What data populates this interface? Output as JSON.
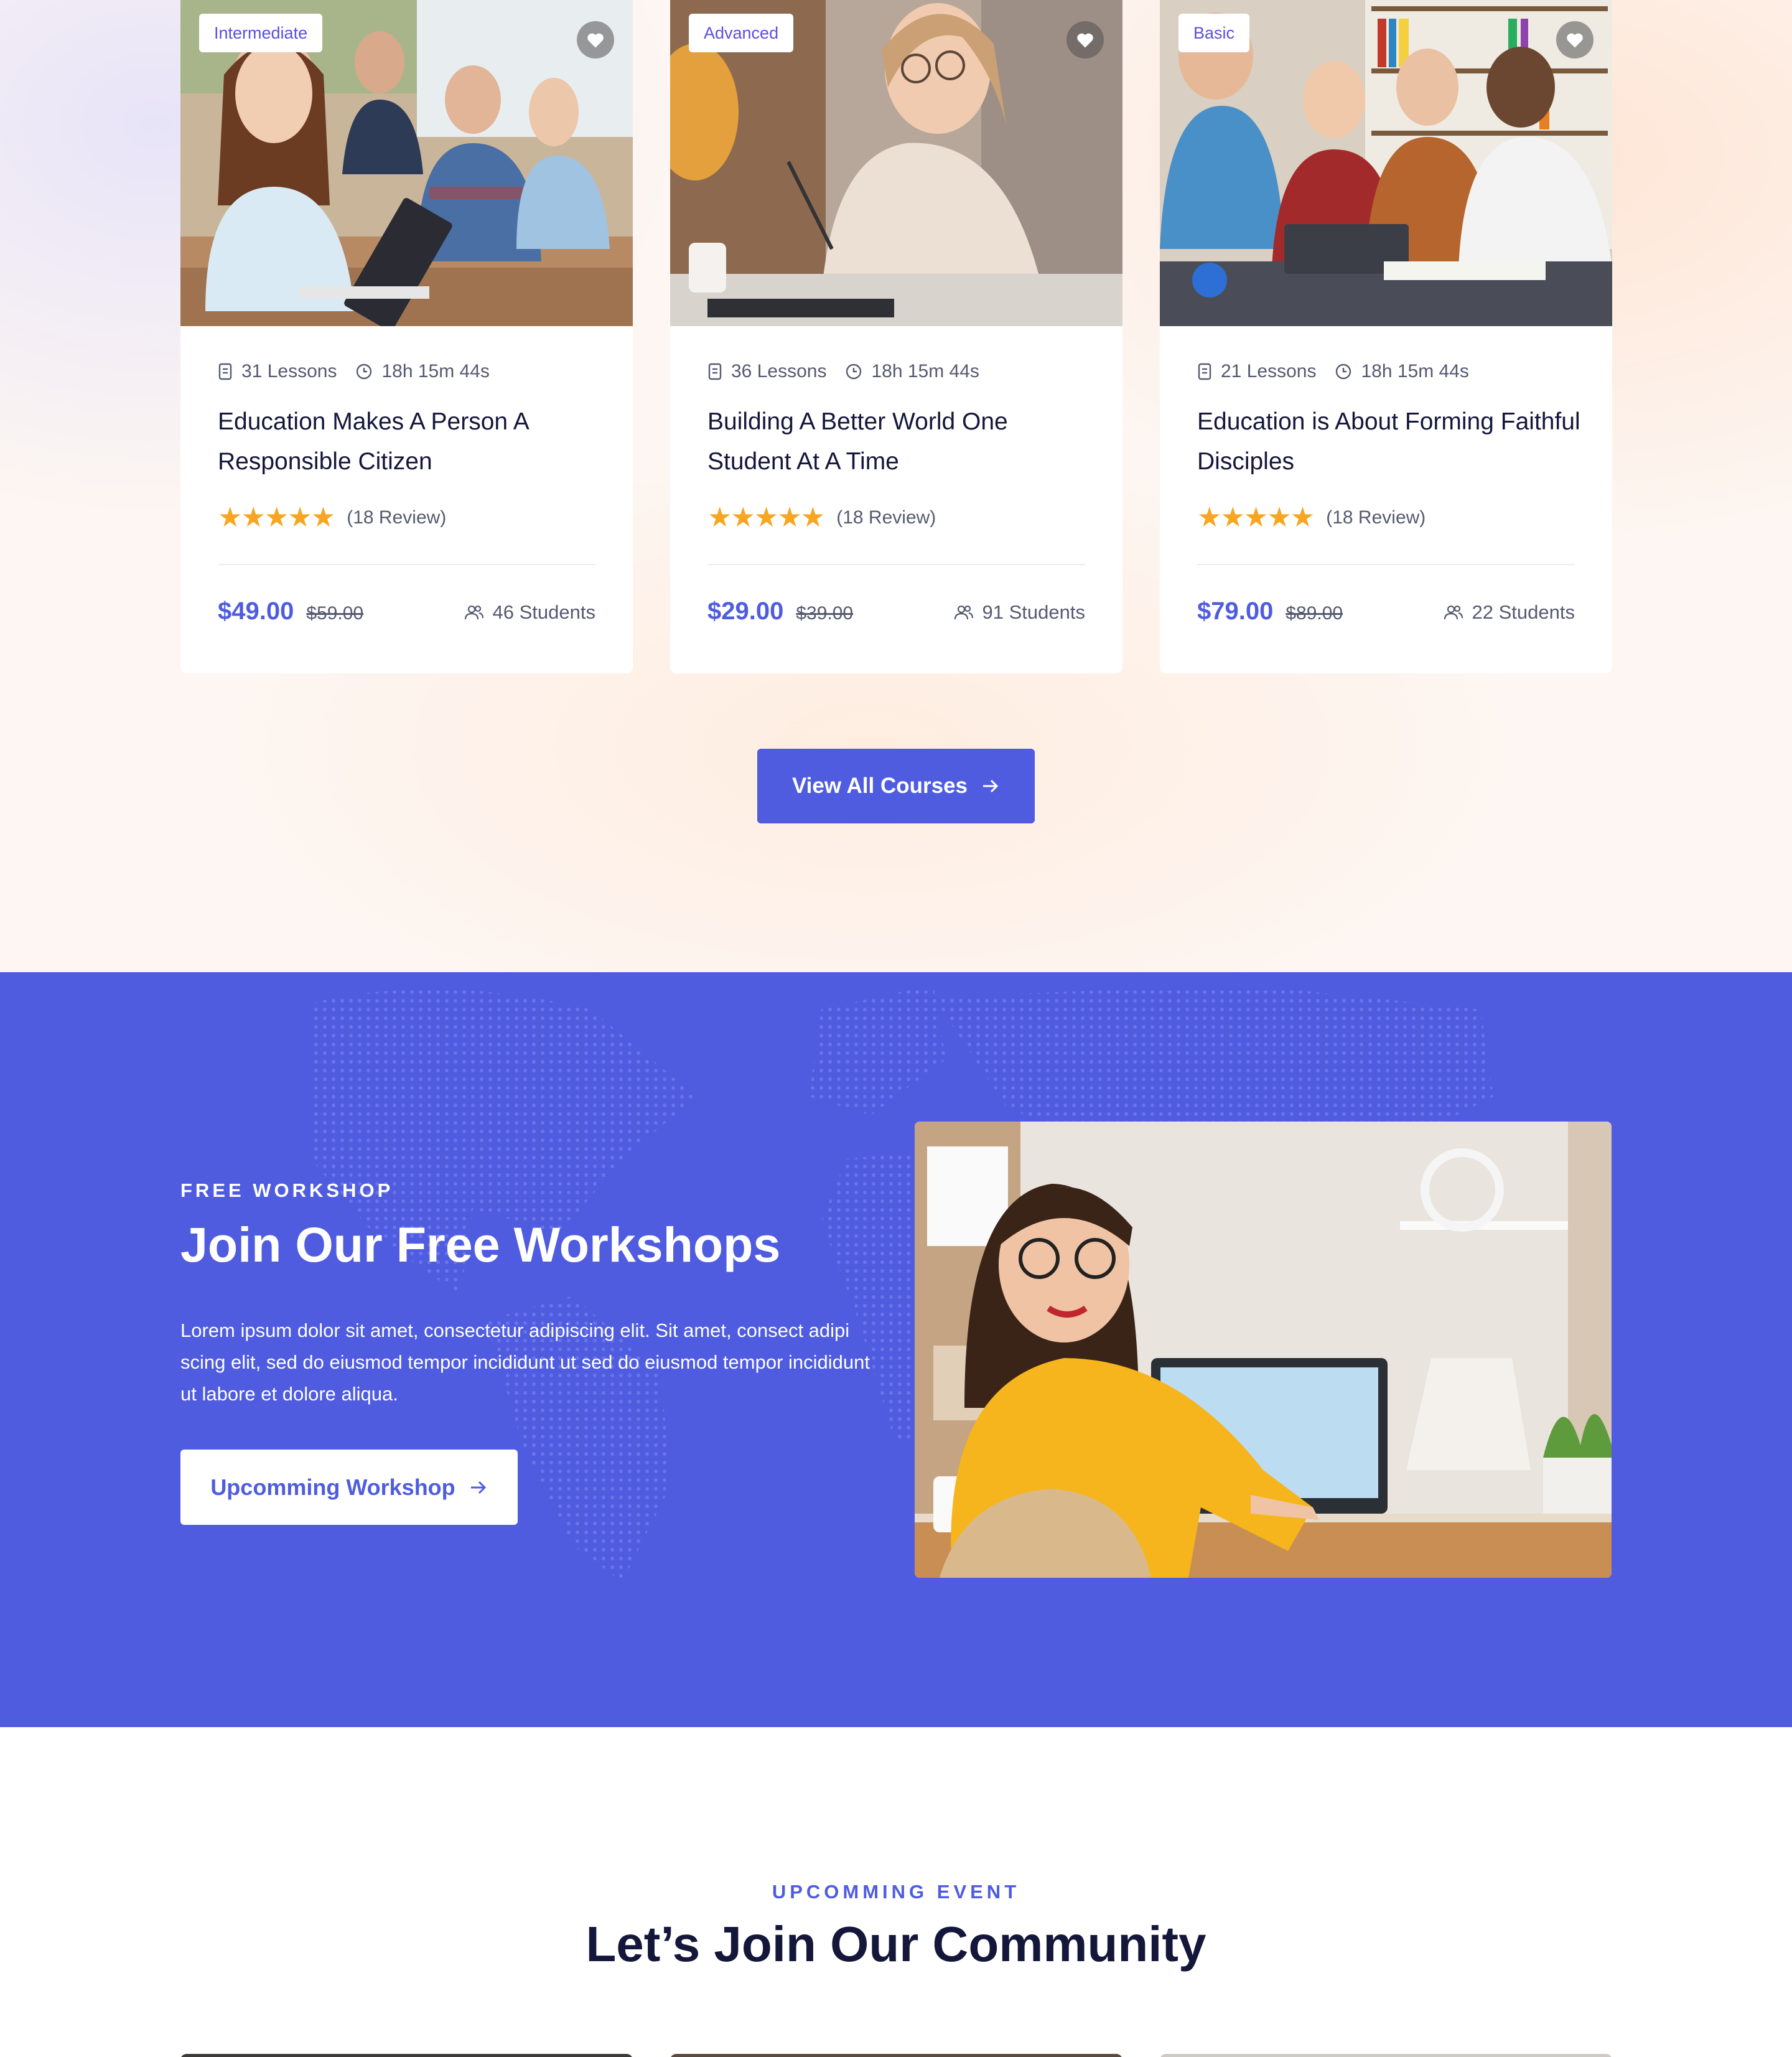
{
  "courses": [
    {
      "level": "Intermediate",
      "lessons": "31 Lessons",
      "duration": "18h 15m 44s",
      "title": "Education Makes A Person A Responsible Citizen",
      "stars": "★★★★★",
      "reviews": "(18 Review)",
      "price": "$49.00",
      "old_price": "$59.00",
      "students": "46 Students",
      "rating": 5
    },
    {
      "level": "Advanced",
      "lessons": "36 Lessons",
      "duration": "18h 15m 44s",
      "title": "Building A Better World One Student At A Time",
      "stars": "★★★★★",
      "reviews": "(18 Review)",
      "price": "$29.00",
      "old_price": "$39.00",
      "students": "91 Students",
      "rating": 5
    },
    {
      "level": "Basic",
      "lessons": "21 Lessons",
      "duration": "18h 15m 44s",
      "title": "Education is About Forming Faithful Disciples",
      "stars": "★★★★★",
      "reviews": "(18 Review)",
      "price": "$79.00",
      "old_price": "$89.00",
      "students": "22 Students",
      "rating": 5
    }
  ],
  "view_all": {
    "label": "View All Courses"
  },
  "workshop": {
    "eyebrow": "FREE WORKSHOP",
    "title": "Join Our Free Workshops",
    "text": "Lorem ipsum dolor sit amet, consectetur adipiscing elit. Sit amet, consect adipi scing elit, sed do eiusmod tempor incididunt ut sed do eiusmod tempor incididunt ut labore et dolore aliqua.",
    "button": "Upcomming Workshop"
  },
  "community": {
    "eyebrow": "UPCOMMING EVENT",
    "title": "Let’s Join Our Community"
  },
  "colors": {
    "accent": "#4f5ce0",
    "star": "#f6a623",
    "heading": "#14173a",
    "muted": "#555a70"
  },
  "icons": [
    "lesson-icon",
    "clock-icon",
    "star-icon",
    "students-icon",
    "heart-icon",
    "arrow-right-icon"
  ]
}
